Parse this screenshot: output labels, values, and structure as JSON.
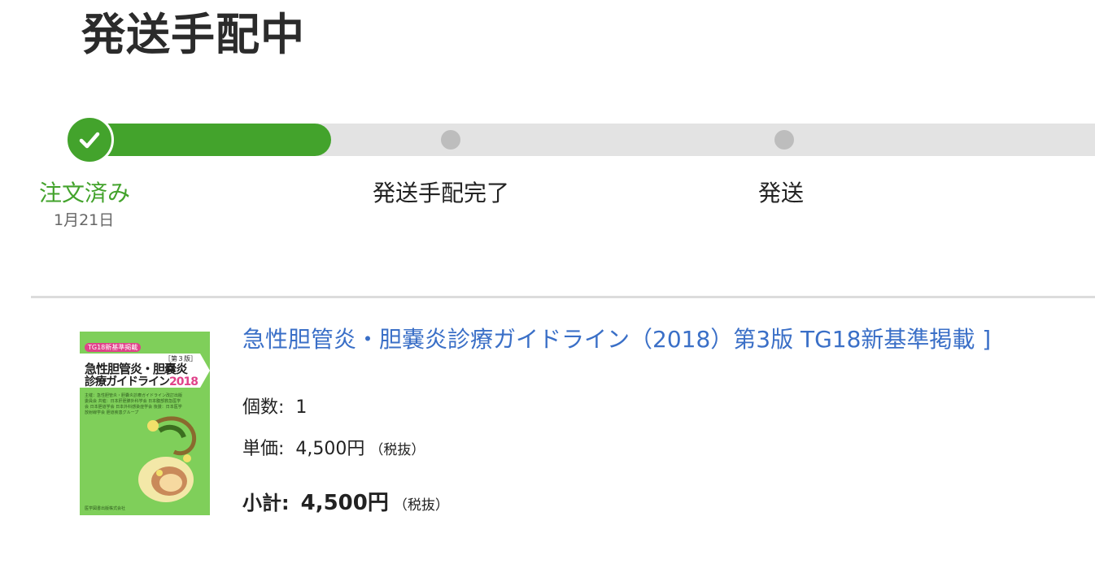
{
  "header": {
    "title": "発送手配中"
  },
  "progress": {
    "steps": [
      {
        "label": "注文済み",
        "date": "1月21日",
        "status": "completed"
      },
      {
        "label": "発送手配完了",
        "status": "pending"
      },
      {
        "label": "発送",
        "status": "pending"
      }
    ],
    "fill_fraction": 0.24,
    "colors": {
      "active": "#43a32c",
      "inactive": "#e3e3e3",
      "dot": "#bdbdbd"
    }
  },
  "product": {
    "title": "急性胆管炎・胆嚢炎診療ガイドライン（2018）第3版 TG18新基準掲載 ]",
    "quantity_label": "個数:",
    "quantity_value": "1",
    "price_label": "単価:",
    "price_value": "4,500円",
    "price_tax_note": "（税抜）",
    "subtotal_label": "小計:",
    "subtotal_value": "4,500円",
    "subtotal_tax_note": "（税抜）",
    "link_color": "#3a6fc7",
    "cover": {
      "tag": "TG18新基準掲載",
      "edition": "［第３版］",
      "title_line1": "急性胆管炎・胆嚢炎",
      "title_line2": "診療ガイドライン",
      "year": "2018",
      "editors": "主催：急性胆管炎・胆嚢炎診療ガイドライン改訂出版委員会 共催：日本肝胆膵外科学会 日本腹部救急医学会 日本胆道学会 日本外科感染症学会 後援：日本医学放射線学会 胆道疾患グループ",
      "publisher": "医学図書出版株式会社",
      "background": "#7fcf5a"
    }
  }
}
